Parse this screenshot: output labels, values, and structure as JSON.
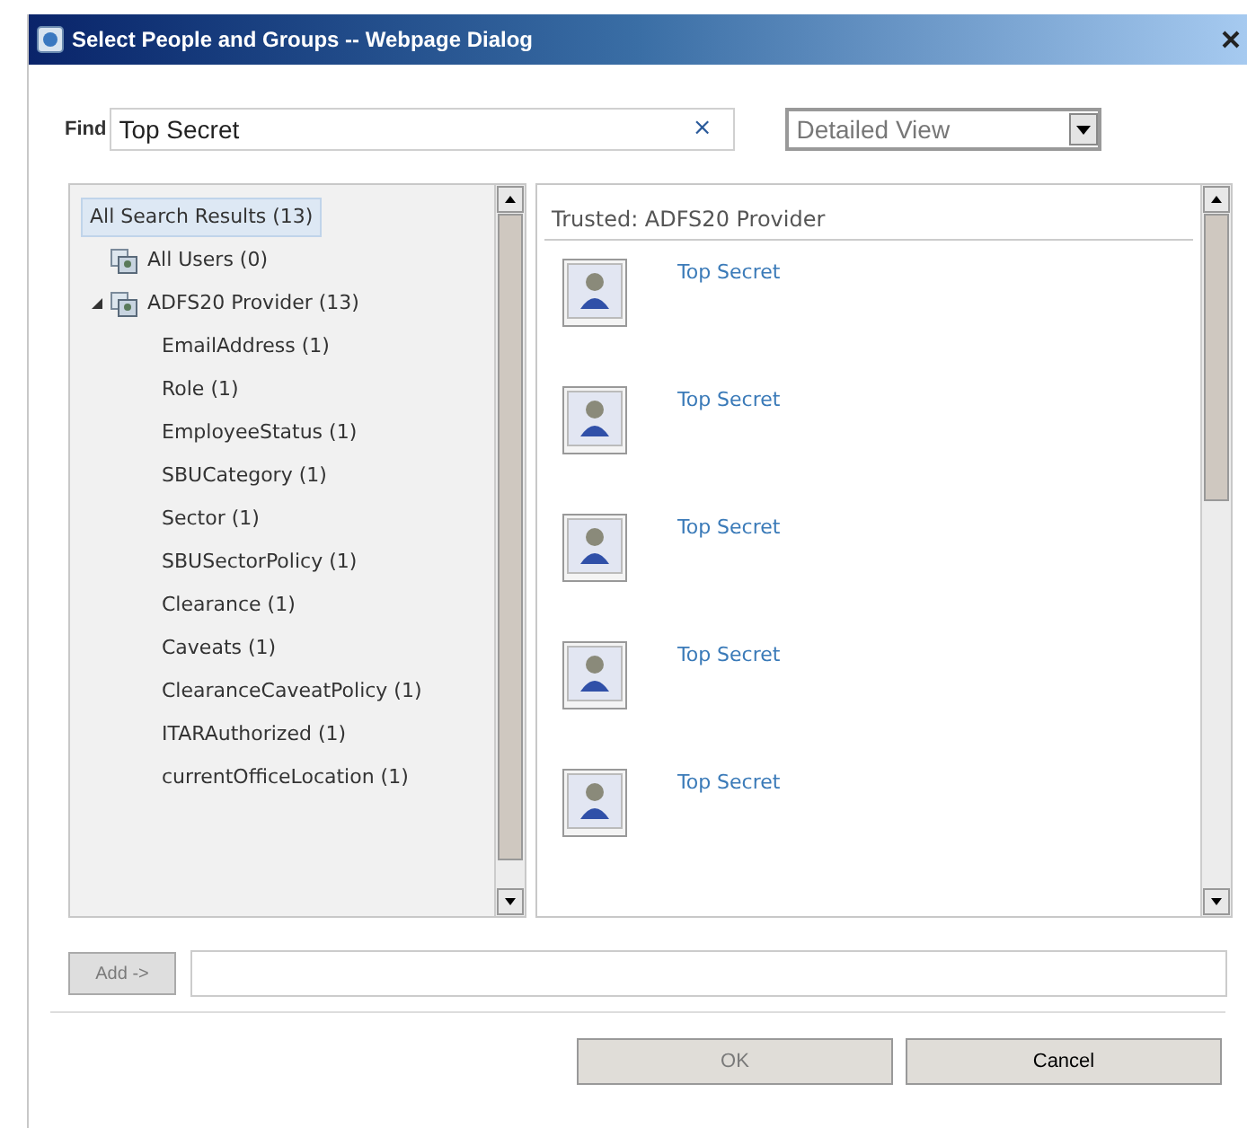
{
  "window": {
    "title": "Select People and Groups -- Webpage Dialog"
  },
  "find": {
    "label": "Find",
    "value": "Top Secret",
    "clear": "×"
  },
  "view_select": {
    "value": "Detailed View"
  },
  "tree": [
    {
      "label": "All Search Results (13)",
      "selected": true,
      "children": [
        {
          "label": "All Users (0)",
          "selected": false
        },
        {
          "label": "ADFS20 Provider (13)",
          "selected": false,
          "expanded": true,
          "children": [
            {
              "label": "EmailAddress (1)",
              "selected": false
            },
            {
              "label": "Role (1)",
              "selected": false
            },
            {
              "label": "EmployeeStatus (1)",
              "selected": false
            },
            {
              "label": "SBUCategory (1)",
              "selected": false
            },
            {
              "label": "Sector (1)",
              "selected": false
            },
            {
              "label": "SBUSectorPolicy (1)",
              "selected": false
            },
            {
              "label": "Clearance (1)",
              "selected": false
            },
            {
              "label": "Caveats (1)",
              "selected": false
            },
            {
              "label": "ClearanceCaveatPolicy (1)",
              "selected": false
            },
            {
              "label": "ITARAuthorized (1)",
              "selected": false
            },
            {
              "label": "currentOfficeLocation (1)",
              "selected": false
            }
          ]
        }
      ]
    }
  ],
  "results": {
    "group": "Trusted: ADFS20 Provider",
    "items": [
      {
        "name": "Top Secret"
      },
      {
        "name": "Top Secret"
      },
      {
        "name": "Top Secret"
      },
      {
        "name": "Top Secret"
      },
      {
        "name": "Top Secret"
      }
    ]
  },
  "add_button": {
    "label": "Add ->",
    "disabled": true
  },
  "buttons": [
    {
      "label": "OK",
      "disabled": true
    },
    {
      "label": "Cancel",
      "disabled": false
    }
  ]
}
